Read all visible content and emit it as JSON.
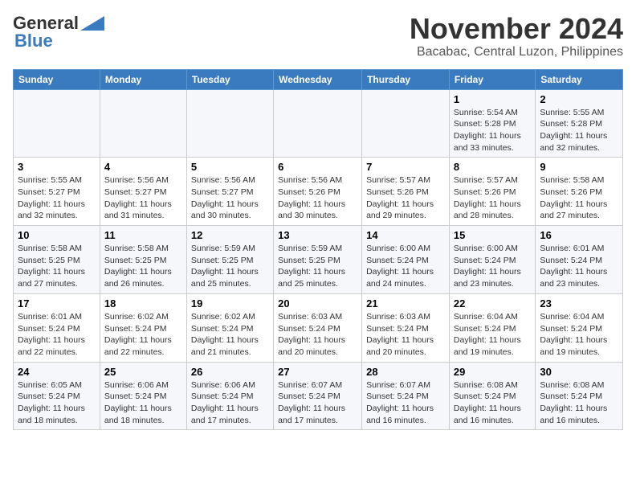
{
  "header": {
    "logo_general": "General",
    "logo_blue": "Blue",
    "title": "November 2024",
    "subtitle": "Bacabac, Central Luzon, Philippines"
  },
  "weekdays": [
    "Sunday",
    "Monday",
    "Tuesday",
    "Wednesday",
    "Thursday",
    "Friday",
    "Saturday"
  ],
  "weeks": [
    [
      {
        "day": "",
        "info": ""
      },
      {
        "day": "",
        "info": ""
      },
      {
        "day": "",
        "info": ""
      },
      {
        "day": "",
        "info": ""
      },
      {
        "day": "",
        "info": ""
      },
      {
        "day": "1",
        "info": "Sunrise: 5:54 AM\nSunset: 5:28 PM\nDaylight: 11 hours\nand 33 minutes."
      },
      {
        "day": "2",
        "info": "Sunrise: 5:55 AM\nSunset: 5:28 PM\nDaylight: 11 hours\nand 32 minutes."
      }
    ],
    [
      {
        "day": "3",
        "info": "Sunrise: 5:55 AM\nSunset: 5:27 PM\nDaylight: 11 hours\nand 32 minutes."
      },
      {
        "day": "4",
        "info": "Sunrise: 5:56 AM\nSunset: 5:27 PM\nDaylight: 11 hours\nand 31 minutes."
      },
      {
        "day": "5",
        "info": "Sunrise: 5:56 AM\nSunset: 5:27 PM\nDaylight: 11 hours\nand 30 minutes."
      },
      {
        "day": "6",
        "info": "Sunrise: 5:56 AM\nSunset: 5:26 PM\nDaylight: 11 hours\nand 30 minutes."
      },
      {
        "day": "7",
        "info": "Sunrise: 5:57 AM\nSunset: 5:26 PM\nDaylight: 11 hours\nand 29 minutes."
      },
      {
        "day": "8",
        "info": "Sunrise: 5:57 AM\nSunset: 5:26 PM\nDaylight: 11 hours\nand 28 minutes."
      },
      {
        "day": "9",
        "info": "Sunrise: 5:58 AM\nSunset: 5:26 PM\nDaylight: 11 hours\nand 27 minutes."
      }
    ],
    [
      {
        "day": "10",
        "info": "Sunrise: 5:58 AM\nSunset: 5:25 PM\nDaylight: 11 hours\nand 27 minutes."
      },
      {
        "day": "11",
        "info": "Sunrise: 5:58 AM\nSunset: 5:25 PM\nDaylight: 11 hours\nand 26 minutes."
      },
      {
        "day": "12",
        "info": "Sunrise: 5:59 AM\nSunset: 5:25 PM\nDaylight: 11 hours\nand 25 minutes."
      },
      {
        "day": "13",
        "info": "Sunrise: 5:59 AM\nSunset: 5:25 PM\nDaylight: 11 hours\nand 25 minutes."
      },
      {
        "day": "14",
        "info": "Sunrise: 6:00 AM\nSunset: 5:24 PM\nDaylight: 11 hours\nand 24 minutes."
      },
      {
        "day": "15",
        "info": "Sunrise: 6:00 AM\nSunset: 5:24 PM\nDaylight: 11 hours\nand 23 minutes."
      },
      {
        "day": "16",
        "info": "Sunrise: 6:01 AM\nSunset: 5:24 PM\nDaylight: 11 hours\nand 23 minutes."
      }
    ],
    [
      {
        "day": "17",
        "info": "Sunrise: 6:01 AM\nSunset: 5:24 PM\nDaylight: 11 hours\nand 22 minutes."
      },
      {
        "day": "18",
        "info": "Sunrise: 6:02 AM\nSunset: 5:24 PM\nDaylight: 11 hours\nand 22 minutes."
      },
      {
        "day": "19",
        "info": "Sunrise: 6:02 AM\nSunset: 5:24 PM\nDaylight: 11 hours\nand 21 minutes."
      },
      {
        "day": "20",
        "info": "Sunrise: 6:03 AM\nSunset: 5:24 PM\nDaylight: 11 hours\nand 20 minutes."
      },
      {
        "day": "21",
        "info": "Sunrise: 6:03 AM\nSunset: 5:24 PM\nDaylight: 11 hours\nand 20 minutes."
      },
      {
        "day": "22",
        "info": "Sunrise: 6:04 AM\nSunset: 5:24 PM\nDaylight: 11 hours\nand 19 minutes."
      },
      {
        "day": "23",
        "info": "Sunrise: 6:04 AM\nSunset: 5:24 PM\nDaylight: 11 hours\nand 19 minutes."
      }
    ],
    [
      {
        "day": "24",
        "info": "Sunrise: 6:05 AM\nSunset: 5:24 PM\nDaylight: 11 hours\nand 18 minutes."
      },
      {
        "day": "25",
        "info": "Sunrise: 6:06 AM\nSunset: 5:24 PM\nDaylight: 11 hours\nand 18 minutes."
      },
      {
        "day": "26",
        "info": "Sunrise: 6:06 AM\nSunset: 5:24 PM\nDaylight: 11 hours\nand 17 minutes."
      },
      {
        "day": "27",
        "info": "Sunrise: 6:07 AM\nSunset: 5:24 PM\nDaylight: 11 hours\nand 17 minutes."
      },
      {
        "day": "28",
        "info": "Sunrise: 6:07 AM\nSunset: 5:24 PM\nDaylight: 11 hours\nand 16 minutes."
      },
      {
        "day": "29",
        "info": "Sunrise: 6:08 AM\nSunset: 5:24 PM\nDaylight: 11 hours\nand 16 minutes."
      },
      {
        "day": "30",
        "info": "Sunrise: 6:08 AM\nSunset: 5:24 PM\nDaylight: 11 hours\nand 16 minutes."
      }
    ]
  ]
}
